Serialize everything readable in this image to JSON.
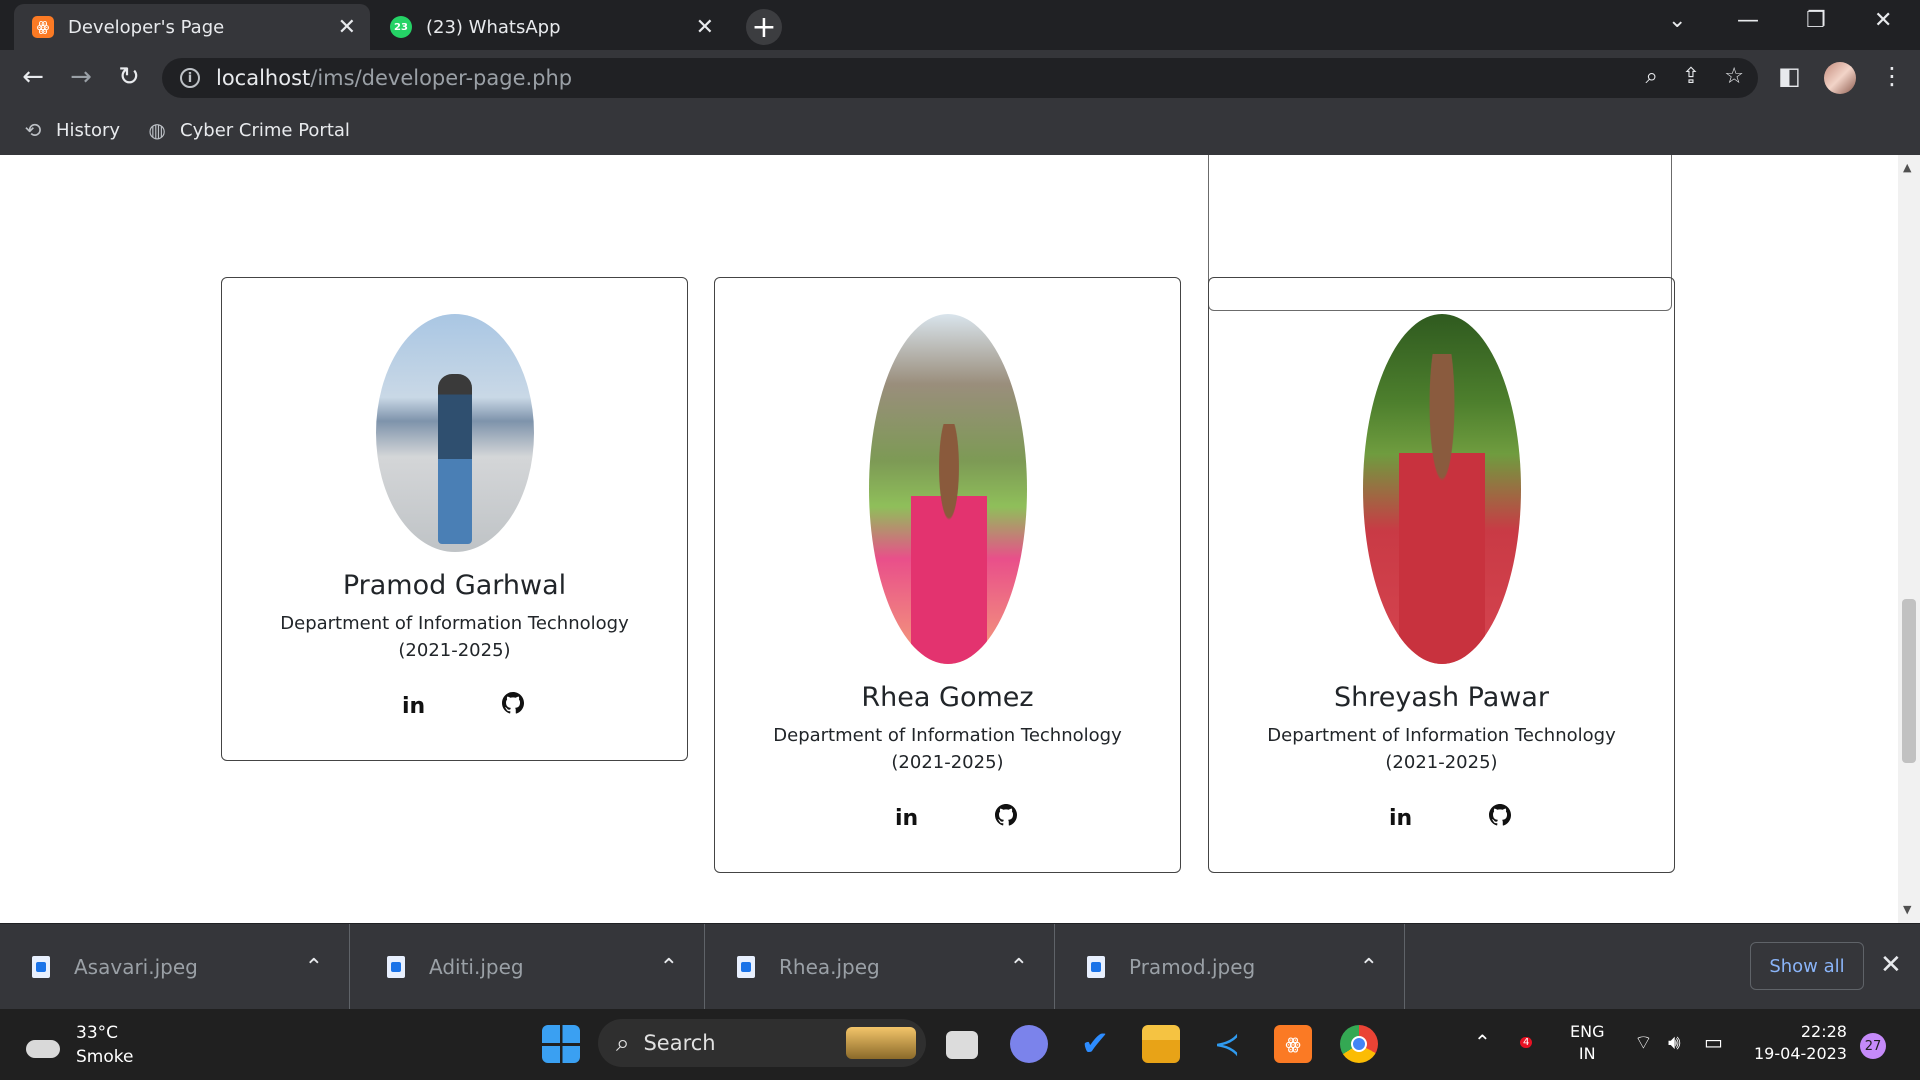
{
  "browser": {
    "tabs": [
      {
        "title": "Developer's Page",
        "favicon": "xampp-icon",
        "active": true
      },
      {
        "title": "(23) WhatsApp",
        "favicon": "whatsapp-icon",
        "badge": "23",
        "active": false
      }
    ],
    "url_host": "localhost",
    "url_path": "/ims/developer-page.php",
    "bookmarks": [
      {
        "label": "History",
        "icon": "history-icon"
      },
      {
        "label": "Cyber Crime Portal",
        "icon": "globe-icon"
      }
    ]
  },
  "developers": [
    {
      "name": "Pramod Garhwal",
      "department": "Department of Information Technology (2021-2025)"
    },
    {
      "name": "Rhea Gomez",
      "department": "Department of Information Technology (2021-2025)"
    },
    {
      "name": "Shreyash Pawar",
      "department": "Department of Information Technology (2021-2025)"
    }
  ],
  "social": {
    "linkedin": "in",
    "github": "github-icon"
  },
  "downloads": {
    "items": [
      "Asavari.jpeg",
      "Aditi.jpeg",
      "Rhea.jpeg",
      "Pramod.jpeg"
    ],
    "show_all": "Show all"
  },
  "taskbar": {
    "weather_temp": "33°C",
    "weather_desc": "Smoke",
    "search_label": "Search",
    "lang_top": "ENG",
    "lang_bottom": "IN",
    "time": "22:28",
    "date": "19-04-2023",
    "notifications": "27",
    "badge_count": "4"
  },
  "colors": {
    "chrome_dark": "#35363a",
    "tabstrip": "#202124",
    "taskbar": "#202020",
    "accent_link": "#8ab4f8"
  }
}
